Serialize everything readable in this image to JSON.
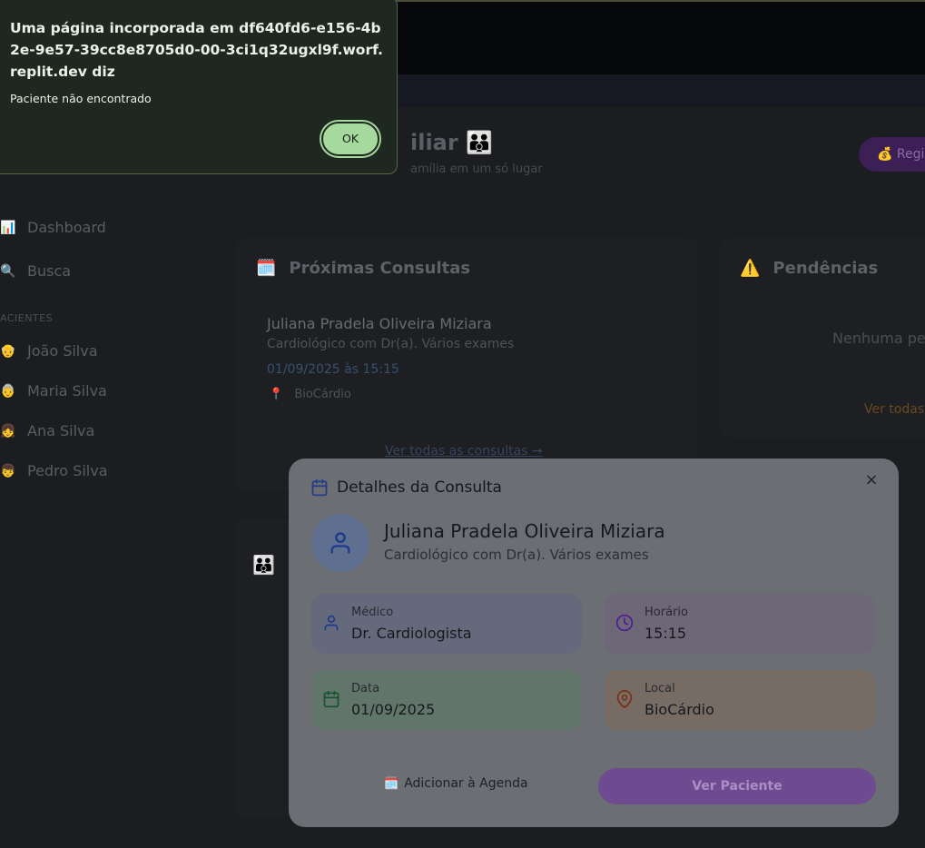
{
  "background": {
    "page_title": "iliar 👪",
    "page_subtitle": "amília em um só lugar",
    "register_button": "💰 Regi",
    "sidebar": {
      "items": [
        {
          "icon": "📊",
          "label": "Dashboard"
        },
        {
          "icon": "🔍",
          "label": "Busca"
        }
      ],
      "patients_heading": "ACIENTES",
      "patients": [
        {
          "icon": "👴",
          "label": "João Silva"
        },
        {
          "icon": "👵",
          "label": "Maria Silva"
        },
        {
          "icon": "👧",
          "label": "Ana Silva"
        },
        {
          "icon": "👦",
          "label": "Pedro Silva"
        }
      ]
    },
    "upcoming": {
      "icon": "🗓️",
      "title": "Próximas Consultas",
      "appointment": {
        "name": "Juliana Pradela Oliveira Miziara",
        "subtitle": "Cardiológico com Dr(a). Vários exames",
        "datetime": "01/09/2025 às 15:15",
        "location_icon": "📍",
        "location": "BioCárdio"
      },
      "see_all": "Ver todas as consultas →"
    },
    "pending": {
      "icon": "⚠️",
      "title": "Pendências",
      "empty": "Nenhuma pe",
      "see_all": "Ver todas"
    },
    "family_icon": "👪"
  },
  "modal": {
    "title": "Detalhes da Consulta",
    "close_label": "×",
    "patient_name": "Juliana Pradela Oliveira Miziara",
    "patient_subtitle": "Cardiológico com Dr(a). Vários exames",
    "fields": {
      "doctor": {
        "label": "Médico",
        "value": "Dr. Cardiologista"
      },
      "time": {
        "label": "Horário",
        "value": "15:15"
      },
      "date": {
        "label": "Data",
        "value": "01/09/2025"
      },
      "location": {
        "label": "Local",
        "value": "BioCárdio"
      }
    },
    "add_to_calendar": "Adicionar à Agenda",
    "add_to_calendar_icon": "🗓️",
    "view_patient": "Ver Paciente",
    "colors": {
      "doctor": "#2563eb",
      "time": "#7e22ce",
      "date": "#15803d",
      "location": "#c2410c"
    }
  },
  "alert": {
    "title": "Uma página incorporada em df640fd6-e156-4b2e-9e57-39cc8e8705d0-00-3ci1q32ugxl9f.worf.replit.dev diz",
    "message": "Paciente não encontrado",
    "ok_label": "OK"
  }
}
